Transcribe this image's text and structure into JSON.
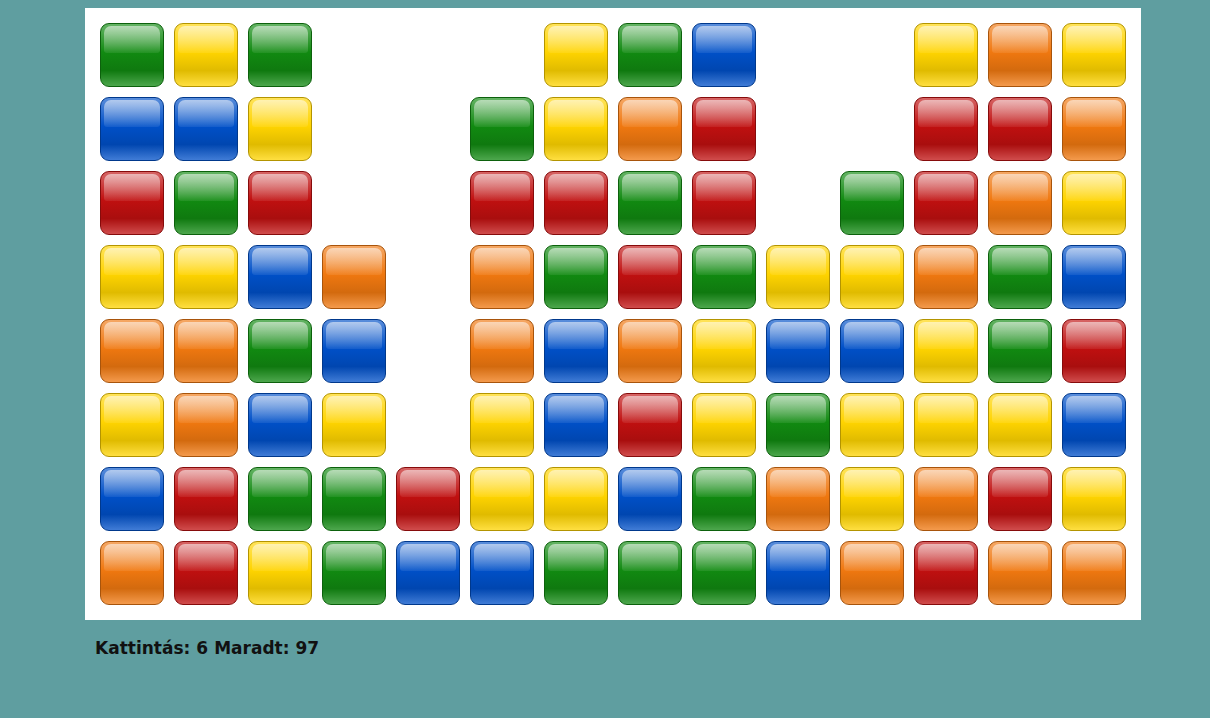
{
  "board": {
    "rows": [
      [
        "#118a11",
        "#ffd400",
        "#118a11",
        null,
        null,
        null,
        "#ffd400",
        "#118a11",
        "#0050c8",
        null,
        null,
        "#ffd400",
        "#f07810",
        "#ffd400"
      ],
      [
        "#0050c8",
        "#0050c8",
        "#ffd400",
        null,
        null,
        "#118a11",
        "#ffd400",
        "#f07810",
        "#c01010",
        null,
        null,
        "#c01010",
        "#c01010",
        "#f07810"
      ],
      [
        "#c01010",
        "#118a11",
        "#c01010",
        null,
        null,
        "#c01010",
        "#c01010",
        "#118a11",
        "#c01010",
        null,
        "#118a11",
        "#c01010",
        "#f07810",
        "#ffd400"
      ],
      [
        "#ffd400",
        "#ffd400",
        "#0050c8",
        "#f07810",
        null,
        "#f07810",
        "#118a11",
        "#c01010",
        "#118a11",
        "#ffd400",
        "#ffd400",
        "#f07810",
        "#118a11",
        "#0050c8"
      ],
      [
        "#f07810",
        "#f07810",
        "#118a11",
        "#0050c8",
        null,
        "#f07810",
        "#0050c8",
        "#f07810",
        "#ffd400",
        "#0050c8",
        "#0050c8",
        "#ffd400",
        "#118a11",
        "#c01010"
      ],
      [
        "#ffd400",
        "#f07810",
        "#0050c8",
        "#ffd400",
        null,
        "#ffd400",
        "#0050c8",
        "#c01010",
        "#ffd400",
        "#118a11",
        "#ffd400",
        "#ffd400",
        "#ffd400",
        "#0050c8"
      ],
      [
        "#0050c8",
        "#c01010",
        "#118a11",
        "#118a11",
        "#c01010",
        "#ffd400",
        "#ffd400",
        "#0050c8",
        "#118a11",
        "#f07810",
        "#ffd400",
        "#f07810",
        "#c01010",
        "#ffd400"
      ],
      [
        "#f07810",
        "#c01010",
        "#ffd400",
        "#118a11",
        "#0050c8",
        "#0050c8",
        "#118a11",
        "#118a11",
        "#118a11",
        "#0050c8",
        "#f07810",
        "#c01010",
        "#f07810",
        "#f07810"
      ]
    ]
  },
  "status": {
    "clicks_label": "Kattintás:",
    "clicks": "6",
    "remaining_label": "Maradt:",
    "remaining": "97"
  }
}
